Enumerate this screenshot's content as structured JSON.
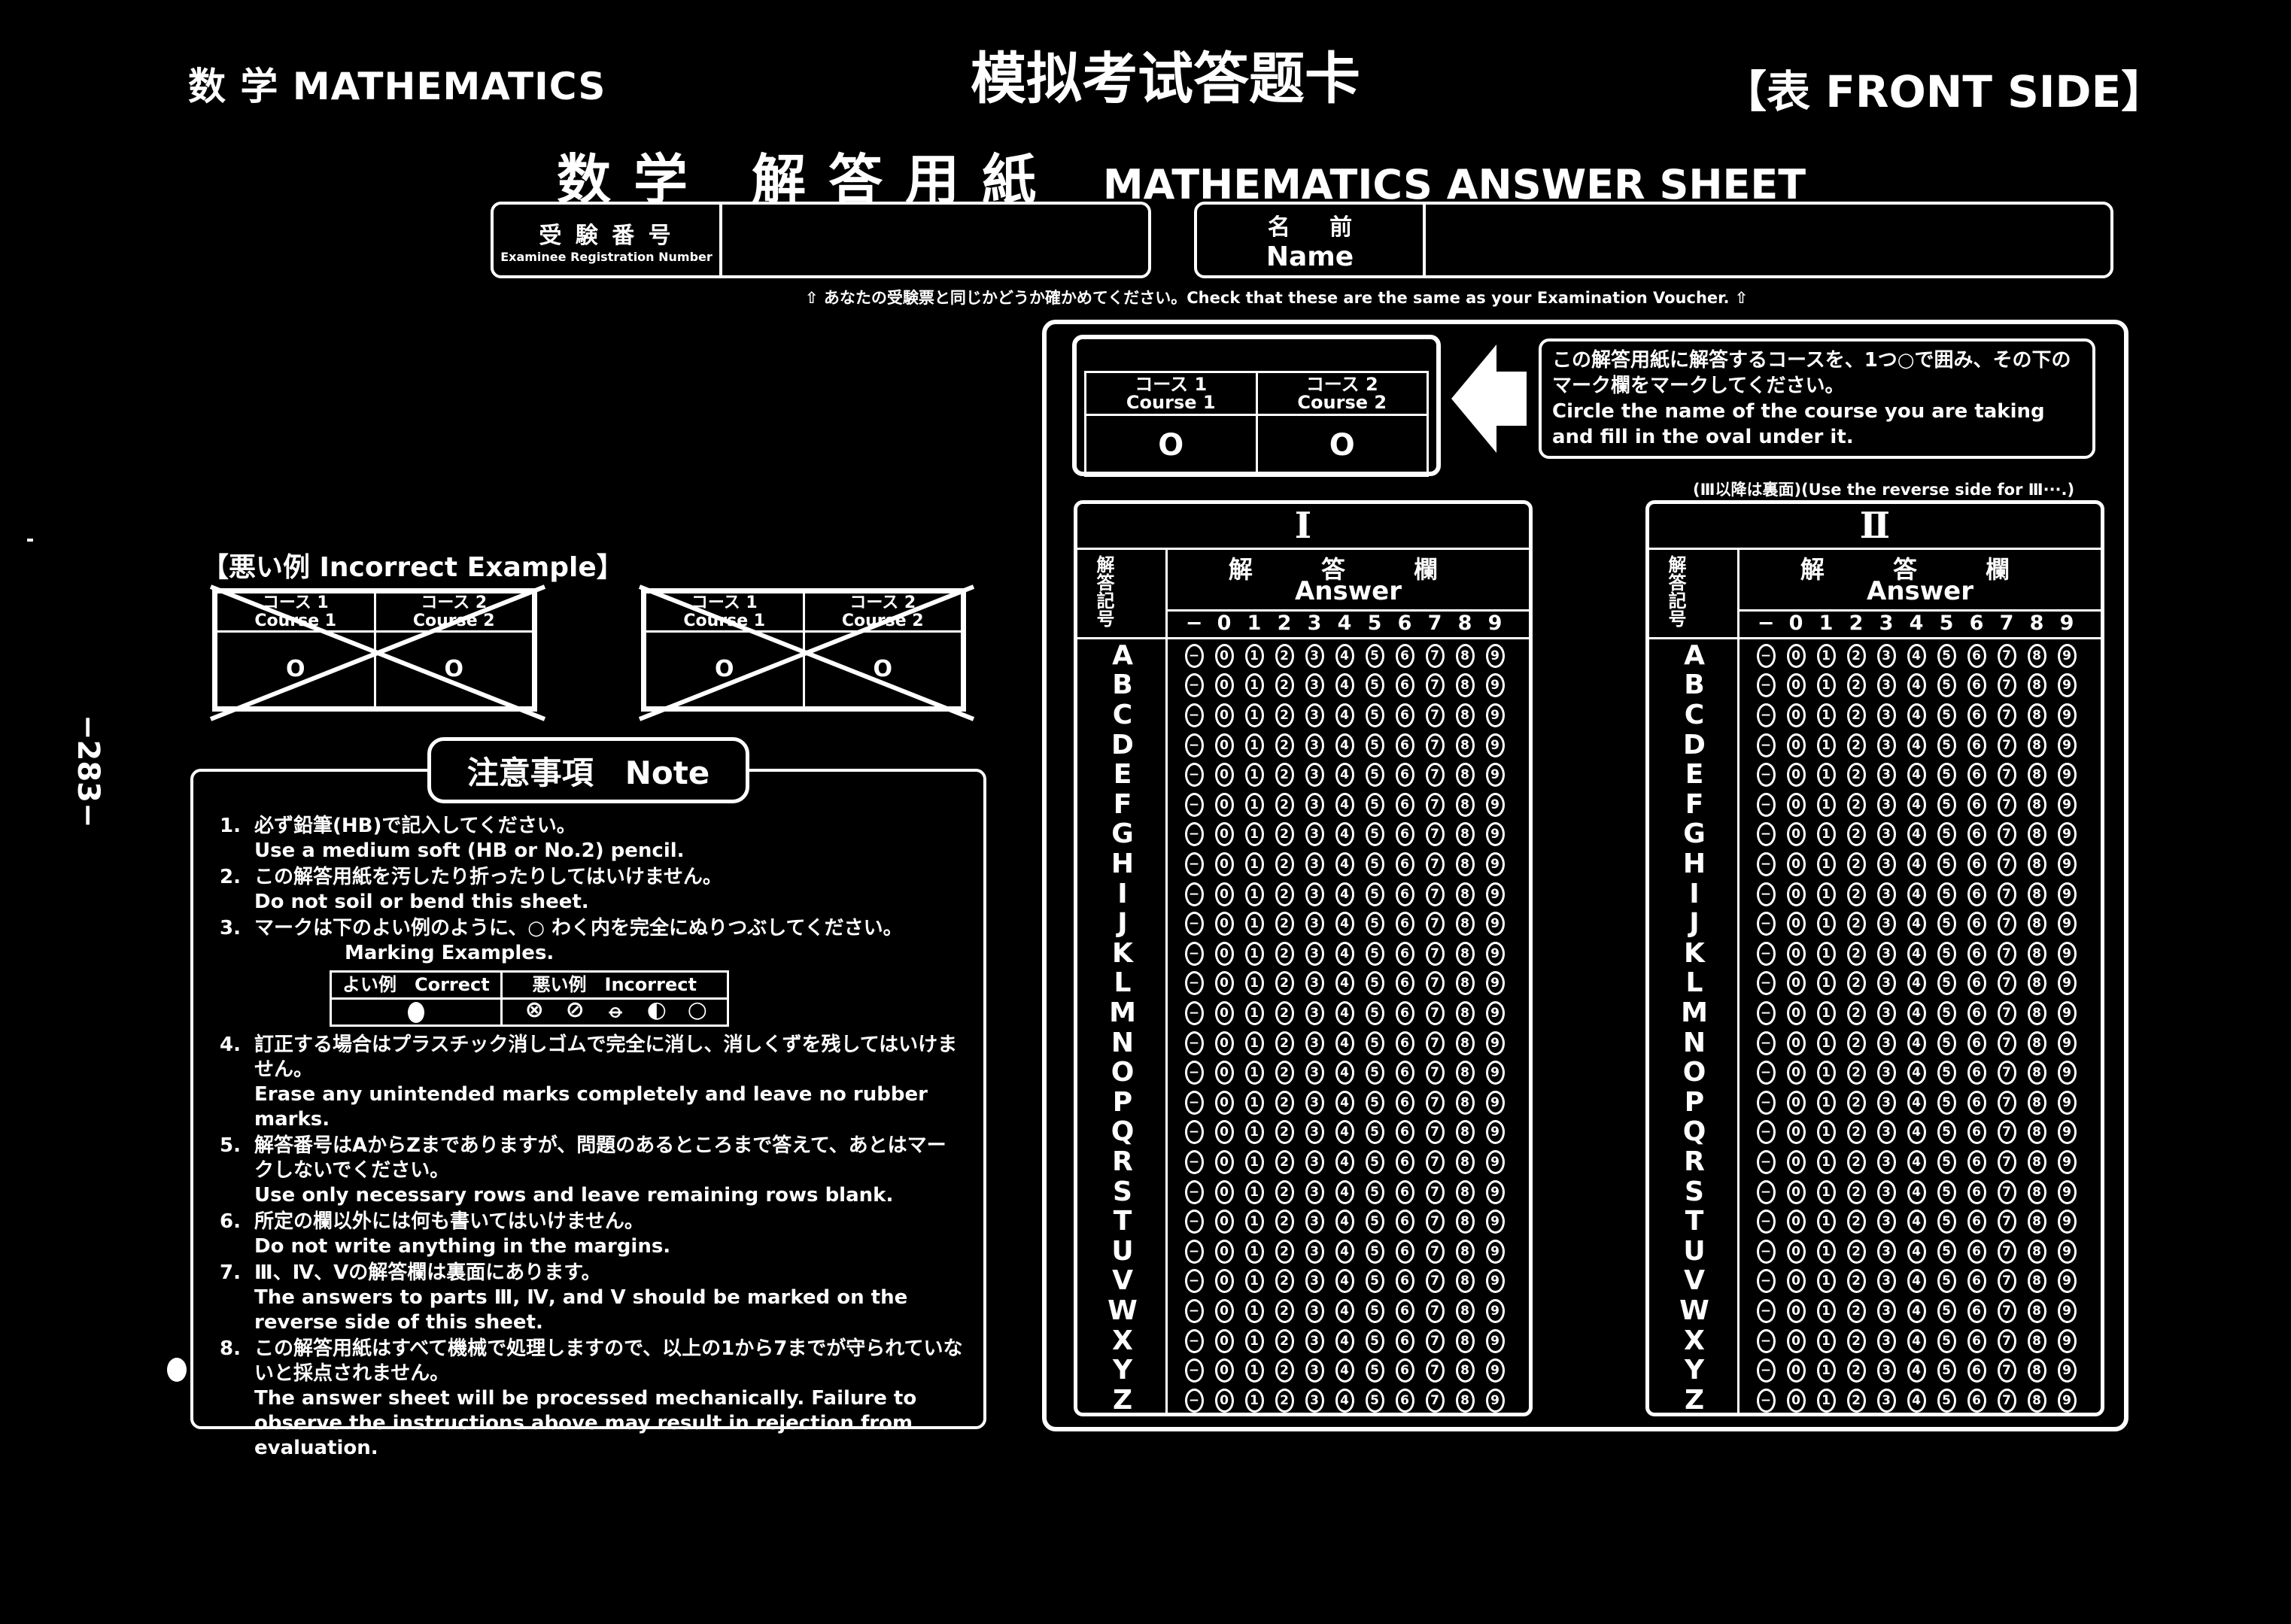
{
  "header": {
    "subject": "数  学  MATHEMATICS",
    "title": "模拟考试答题卡",
    "side": "【表  FRONT SIDE】",
    "sheet_title_jp": "数学 解答用紙",
    "sheet_title_en": "MATHEMATICS ANSWER SHEET"
  },
  "id_fields": {
    "exam_number_jp": "受 験 番 号",
    "exam_number_en": "Examinee Registration Number",
    "name_jp": "名     前",
    "name_en": "Name",
    "exam_number_value": "",
    "name_value": "",
    "verify_note": "⇧ あなたの受験票と同じかどうか確かめてください。Check that these are the same as your Examination Voucher. ⇧"
  },
  "page_number": "−283−",
  "incorrect_example": {
    "heading": "【悪い例 Incorrect Example】",
    "course1_jp": "コース 1",
    "course1_en": "Course 1",
    "course2_jp": "コース 2",
    "course2_en": "Course 2",
    "mark": "O"
  },
  "note": {
    "title": "注意事項　Note",
    "items": [
      {
        "num": "1.",
        "jp": "必ず鉛筆(HB)で記入してください。",
        "en": "Use a medium soft (HB or No.2) pencil."
      },
      {
        "num": "2.",
        "jp": "この解答用紙を汚したり折ったりしてはいけません。",
        "en": "Do not soil or bend this sheet."
      },
      {
        "num": "3.",
        "jp": "マークは下のよい例のように、○ わく内を完全にぬりつぶしてください。",
        "en": "Marking Examples."
      },
      {
        "num": "4.",
        "jp": "訂正する場合はプラスチック消しゴムで完全に消し、消しくずを残してはいけません。",
        "en": "Erase any unintended marks completely and leave no rubber marks."
      },
      {
        "num": "5.",
        "jp": "解答番号はAからZまでありますが、問題のあるところまで答えて、あとはマークしないでください。",
        "en": "Use only necessary rows and leave remaining rows blank."
      },
      {
        "num": "6.",
        "jp": "所定の欄以外には何も書いてはいけません。",
        "en": "Do not write anything in the margins."
      },
      {
        "num": "7.",
        "jp": "Ⅲ、Ⅳ、Ⅴの解答欄は裏面にあります。",
        "en": "The answers to parts Ⅲ, Ⅳ, and Ⅴ should be marked on the reverse side of this sheet."
      },
      {
        "num": "8.",
        "jp": "この解答用紙はすべて機械で処理しますので、以上の1から7までが守られていないと採点されません。",
        "en": "The answer sheet will be processed mechanically. Failure to observe the instructions above may result in rejection from evaluation."
      }
    ],
    "marking": {
      "correct_label": "よい例　Correct",
      "incorrect_label": "悪い例　Incorrect",
      "incorrect_marks": [
        "⊗",
        "⊘",
        "⦵",
        "◐",
        "○"
      ]
    }
  },
  "course_select": {
    "course1_jp": "コース 1",
    "course1_en": "Course 1",
    "course2_jp": "コース 2",
    "course2_en": "Course 2",
    "mark": "O",
    "instruction_jp": "この解答用紙に解答するコースを、1つ○で囲み、その下のマーク欄をマークしてください。",
    "instruction_en": "Circle the name of the course you are taking and fill in the oval under it.",
    "reverse_note": "(Ⅲ以降は裏面)(Use the reverse side for Ⅲ···.)"
  },
  "answer_sections": [
    {
      "roman": "Ⅰ",
      "label_jp": "解 答 欄",
      "label_en": "Answer",
      "side_label": "解答記号"
    },
    {
      "roman": "Ⅱ",
      "label_jp": "解 答 欄",
      "label_en": "Answer",
      "side_label": "解答記号"
    }
  ],
  "digits": [
    "−",
    "0",
    "1",
    "2",
    "3",
    "4",
    "5",
    "6",
    "7",
    "8",
    "9"
  ],
  "rows": [
    "A",
    "B",
    "C",
    "D",
    "E",
    "F",
    "G",
    "H",
    "I",
    "J",
    "K",
    "L",
    "M",
    "N",
    "O",
    "P",
    "Q",
    "R",
    "S",
    "T",
    "U",
    "V",
    "W",
    "X",
    "Y",
    "Z"
  ]
}
